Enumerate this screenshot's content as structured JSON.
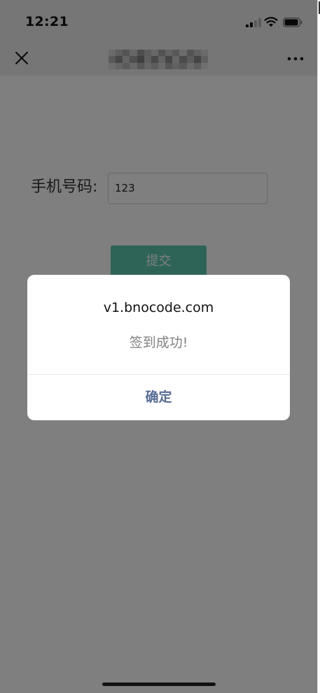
{
  "status_bar": {
    "time": "12:21",
    "signal_icon": "cellular-signal-icon",
    "signal_bars_active": 2,
    "signal_bars_total": 4,
    "wifi_icon": "wifi-icon",
    "battery_icon": "battery-icon",
    "battery_level": 0.85
  },
  "nav_bar": {
    "close_icon": "close-icon",
    "title": "",
    "title_blurred": true,
    "more_icon": "more-icon"
  },
  "form": {
    "phone_label": "手机号码:",
    "phone_value": "123",
    "submit_label": "提交",
    "submit_color": "#5cc9b0"
  },
  "dialog": {
    "title": "v1.bnocode.com",
    "message": "签到成功!",
    "confirm_label": "确定",
    "confirm_color": "#576b95"
  }
}
